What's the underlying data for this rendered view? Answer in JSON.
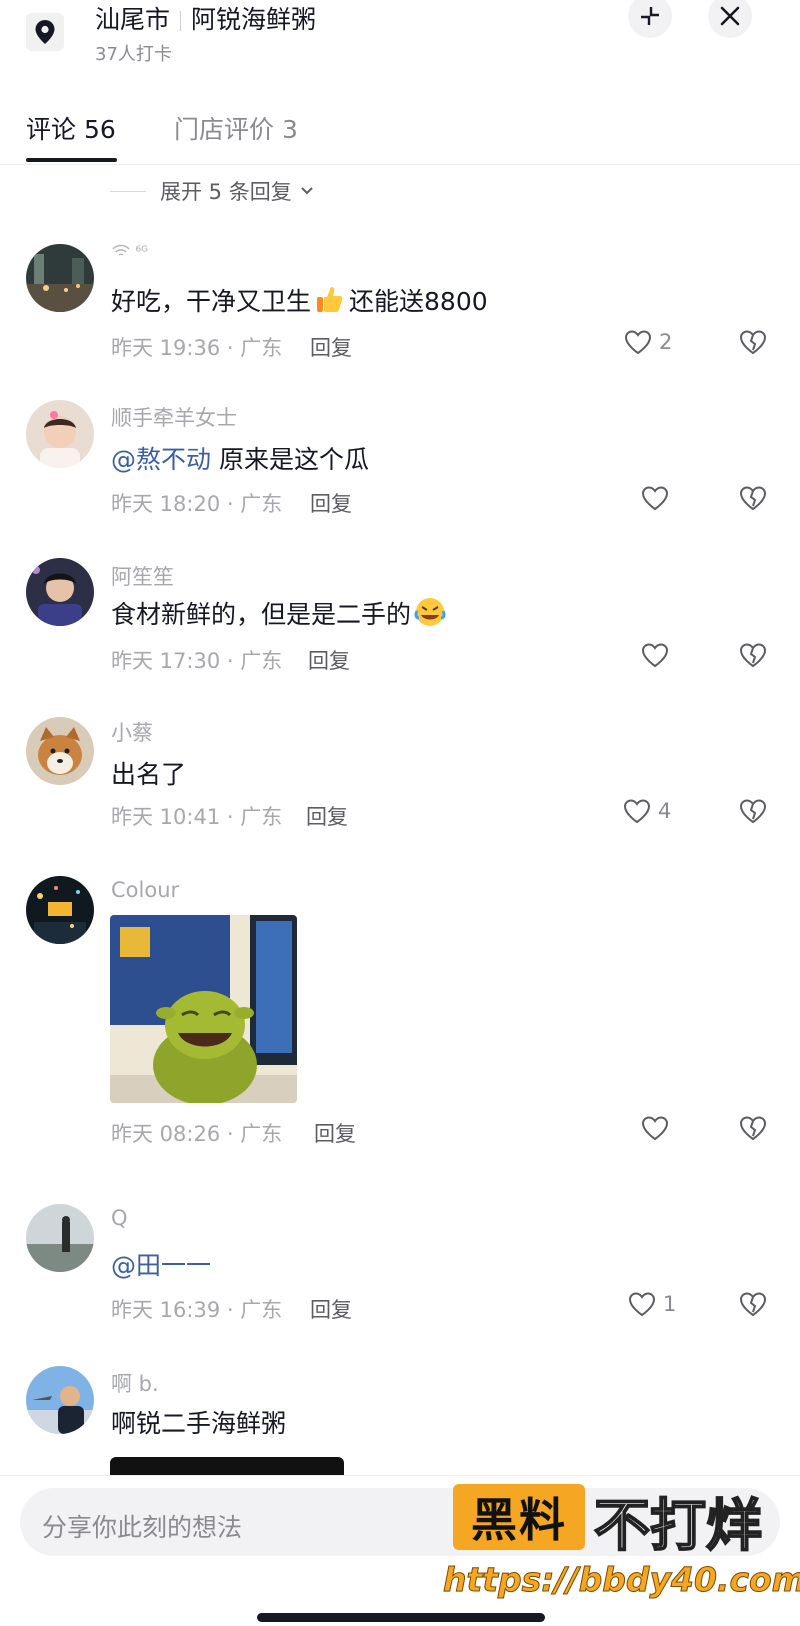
{
  "header": {
    "city": "汕尾市",
    "place": "阿锐海鲜粥",
    "checkins": "37人打卡",
    "icons": {
      "location": "location-pin-icon",
      "collapse": "collapse-icon",
      "close": "close-icon"
    }
  },
  "tabs": [
    {
      "label": "评论 56",
      "active": true
    },
    {
      "label": "门店评价 3",
      "active": false
    }
  ],
  "expand_replies": "展开 5 条回复",
  "comments": [
    {
      "name": "⁶ᴳ",
      "text": "好吃，干净又卫生",
      "text_suffix": "还能送8800",
      "emoji": "thumbs-up",
      "time": "昨天 19:36 · 广东",
      "reply": "回复",
      "likes": "2"
    },
    {
      "name": "顺手牵羊女士",
      "mention": "@熬不动",
      "text": " 原来是这个瓜",
      "time": "昨天 18:20 · 广东",
      "reply": "回复",
      "likes": ""
    },
    {
      "name": "阿笙笙",
      "text": "食材新鲜的，但是是二手的",
      "emoji": "rofl",
      "time": "昨天 17:30 · 广东",
      "reply": "回复",
      "likes": ""
    },
    {
      "name": "小蔡",
      "text": "出名了",
      "time": "昨天 10:41 · 广东",
      "reply": "回复",
      "likes": "4"
    },
    {
      "name": "Colour",
      "image": "shrek-laughing-gif",
      "time": "昨天 08:26 · 广东",
      "reply": "回复",
      "likes": ""
    },
    {
      "name": "Q",
      "mention": "@田一一",
      "text": "",
      "time": "昨天 16:39 · 广东",
      "reply": "回复",
      "likes": "1"
    },
    {
      "name": "啊 b.",
      "text": "啊锐二手海鲜粥"
    }
  ],
  "input": {
    "placeholder": "分享你此刻的想法"
  },
  "watermark": {
    "box": "黑料",
    "text": "不打烊",
    "url": "https://bbdy40.com"
  },
  "colors": {
    "mention": "#3d5fa0",
    "muted": "#a7a8ad",
    "watermark": "#f5a623"
  }
}
